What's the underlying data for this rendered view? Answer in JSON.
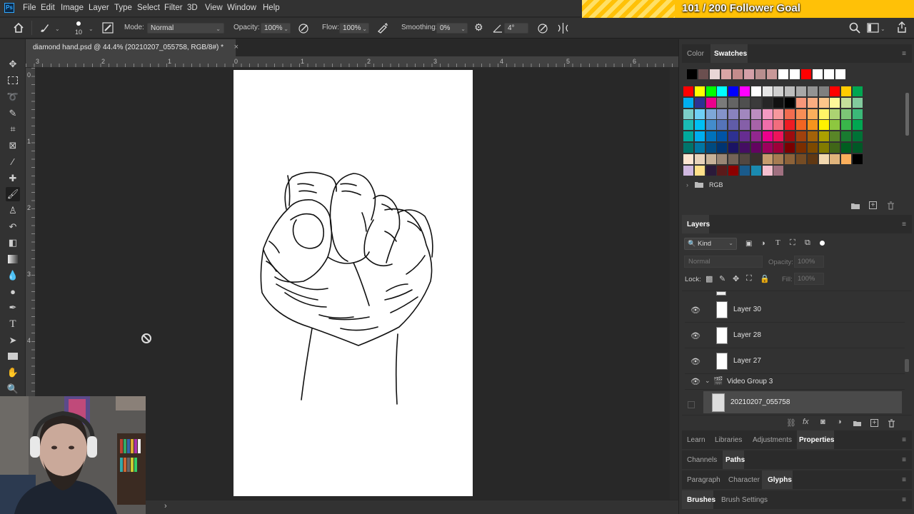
{
  "app": {
    "logo": "Ps"
  },
  "menu": [
    "File",
    "Edit",
    "Image",
    "Layer",
    "Type",
    "Select",
    "Filter",
    "3D",
    "View",
    "Window",
    "Help"
  ],
  "overlay": {
    "goal_text": "101 / 200 Follower Goal",
    "accent": "#ffc107"
  },
  "options_bar": {
    "brush_size": "10",
    "mode_label": "Mode:",
    "mode_value": "Normal",
    "opacity_label": "Opacity:",
    "opacity_value": "100%",
    "flow_label": "Flow:",
    "flow_value": "100%",
    "smoothing_label": "Smoothing:",
    "smoothing_value": "0%",
    "angle_value": "4°"
  },
  "document": {
    "tab_title": "diamond hand.psd @ 44.4% (20210207_055758, RGB/8#) *",
    "close": "×"
  },
  "rulers": {
    "horizontal": [
      "3",
      "2",
      "1",
      "0",
      "1",
      "2",
      "3",
      "4",
      "5",
      "6"
    ],
    "vertical": [
      "0",
      "1",
      "2",
      "3",
      "4"
    ]
  },
  "color_panel": {
    "tabs": [
      "Color",
      "Swatches"
    ],
    "active_tab": "Swatches",
    "folder_label": "RGB"
  },
  "layers_panel": {
    "title": "Layers",
    "filter_kind": "Kind",
    "blend_mode": "Normal",
    "opacity_label": "Opacity:",
    "opacity_value": "100%",
    "lock_label": "Lock:",
    "fill_label": "Fill:",
    "fill_value": "100%",
    "layers": [
      {
        "name": "Layer 30",
        "visible": true
      },
      {
        "name": "Layer 28",
        "visible": true
      },
      {
        "name": "Layer 27",
        "visible": true
      }
    ],
    "group": {
      "name": "Video Group 3",
      "visible": true
    },
    "video_layer": {
      "name": "20210207_055758",
      "selected": true
    }
  },
  "bottom_tabs": {
    "row1": [
      "Learn",
      "Libraries",
      "Adjustments",
      "Properties"
    ],
    "row1_active": "Properties",
    "row2": [
      "Channels",
      "Paths"
    ],
    "row2_active": "Paths",
    "row3": [
      "Paragraph",
      "Character",
      "Glyphs"
    ],
    "row3_active": "Glyphs",
    "row4": [
      "Brushes",
      "Brush Settings"
    ],
    "row4_active": "Brushes"
  },
  "icons": [
    "home-icon",
    "brush-icon",
    "search-icon",
    "share-icon",
    "eye-icon",
    "folder-icon",
    "trash-icon",
    "pressure-opacity-icon",
    "airbrush-icon",
    "settings-icon",
    "symmetry-icon"
  ]
}
